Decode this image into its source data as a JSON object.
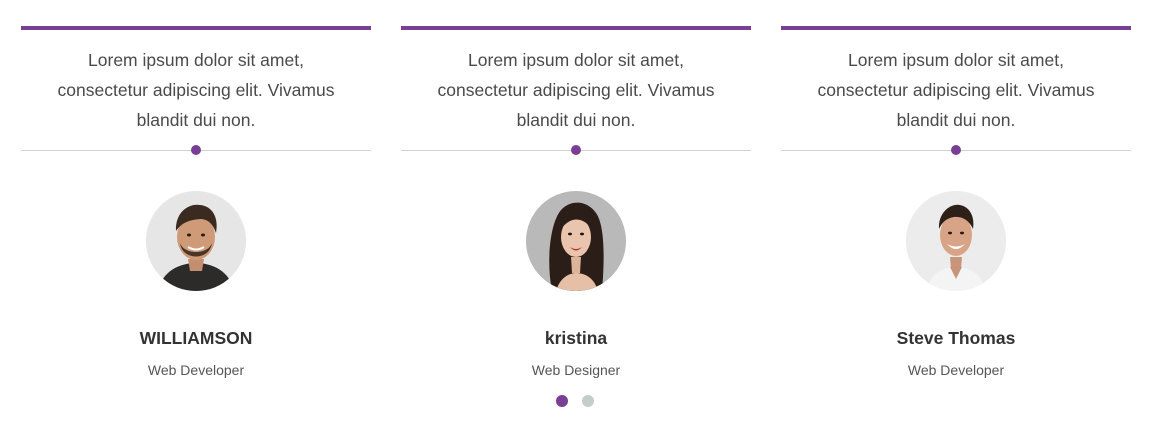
{
  "accent_color": "#7a3f93",
  "inactive_dot_color": "#c4cccc",
  "testimonials": [
    {
      "quote": "Lorem ipsum dolor sit amet, consectetur adipiscing elit. Vivamus blandit dui non.",
      "name": "WILLIAMSON",
      "role": "Web Developer",
      "avatar_icon": "man-with-beard-portrait"
    },
    {
      "quote": "Lorem ipsum dolor sit amet, consectetur adipiscing elit. Vivamus blandit dui non.",
      "name": "kristina",
      "role": "Web Designer",
      "avatar_icon": "woman-portrait"
    },
    {
      "quote": "Lorem ipsum dolor sit amet, consectetur adipiscing elit. Vivamus blandit dui non.",
      "name": "Steve Thomas",
      "role": "Web Developer",
      "avatar_icon": "smiling-man-portrait"
    }
  ],
  "pagination": {
    "total_pages": 2,
    "active_page": 1
  }
}
